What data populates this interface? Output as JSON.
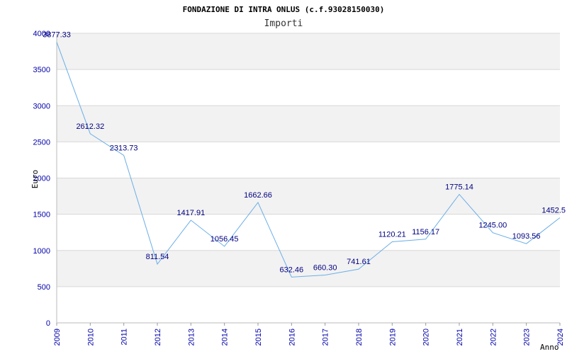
{
  "chart_data": {
    "type": "line",
    "title": "FONDAZIONE DI INTRA ONLUS (c.f.93028150030)",
    "subtitle": "Importi",
    "xlabel": "Anno",
    "ylabel": "Euro",
    "ylim": [
      0,
      4000
    ],
    "yticks": [
      0,
      500,
      1000,
      1500,
      2000,
      2500,
      3000,
      3500,
      4000
    ],
    "grid": true,
    "x": [
      "2009",
      "2010",
      "2011",
      "2012",
      "2013",
      "2014",
      "2015",
      "2016",
      "2017",
      "2018",
      "2019",
      "2020",
      "2021",
      "2022",
      "2023",
      "2024"
    ],
    "values": [
      3877.33,
      2612.32,
      2313.73,
      811.54,
      1417.91,
      1056.45,
      1662.66,
      632.46,
      660.3,
      741.61,
      1120.21,
      1156.17,
      1775.14,
      1245.0,
      1093.56,
      1452.5
    ],
    "data_labels": [
      "3877.33",
      "2612.32",
      "2313.73",
      "811.54",
      "1417.91",
      "1056.45",
      "1662.66",
      "632.46",
      "660.30",
      "741.61",
      "1120.21",
      "1156.17",
      "1775.14",
      "1245.00",
      "1093.56",
      "1452.5"
    ],
    "colors": {
      "line": "#6aaee8",
      "band": "#f2f2f2",
      "grid": "#d8d8d8",
      "tick": "#0000aa",
      "label": "#000080"
    }
  }
}
